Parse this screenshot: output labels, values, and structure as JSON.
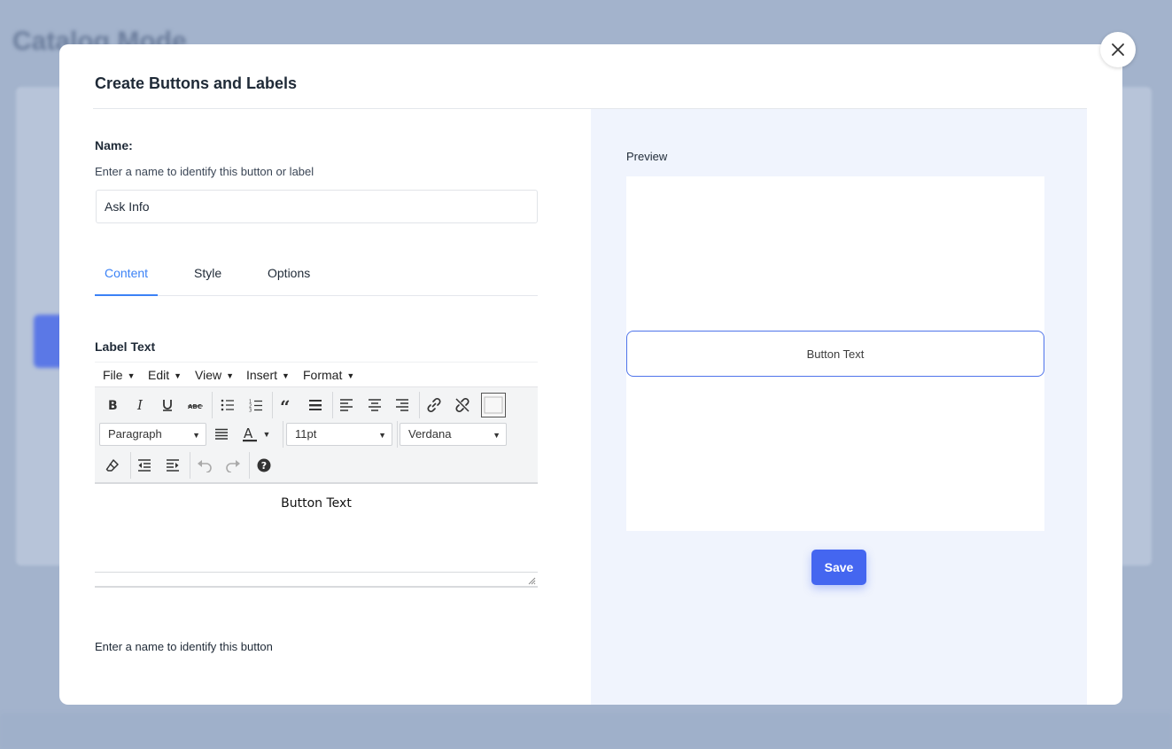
{
  "background": {
    "title": "Catalog Mode"
  },
  "modal": {
    "title": "Create Buttons and Labels",
    "close_icon": "close-icon"
  },
  "form": {
    "name_label": "Name:",
    "name_help": "Enter a name to identify this button or label",
    "name_value": "Ask Info",
    "tabs": [
      {
        "label": "Content",
        "active": true
      },
      {
        "label": "Style",
        "active": false
      },
      {
        "label": "Options",
        "active": false
      }
    ],
    "label_text_label": "Label Text",
    "label_help": "Enter a name to identify this button"
  },
  "editor": {
    "menu": [
      "File",
      "Edit",
      "View",
      "Insert",
      "Format"
    ],
    "block_format": "Paragraph",
    "font_size": "11pt",
    "font_family": "Verdana",
    "content": "Button Text"
  },
  "preview": {
    "label": "Preview",
    "button_text": "Button Text",
    "save_label": "Save"
  },
  "colors": {
    "accent": "#3b82f6",
    "save": "#4466f0",
    "preview_bg": "#f0f4fd"
  }
}
